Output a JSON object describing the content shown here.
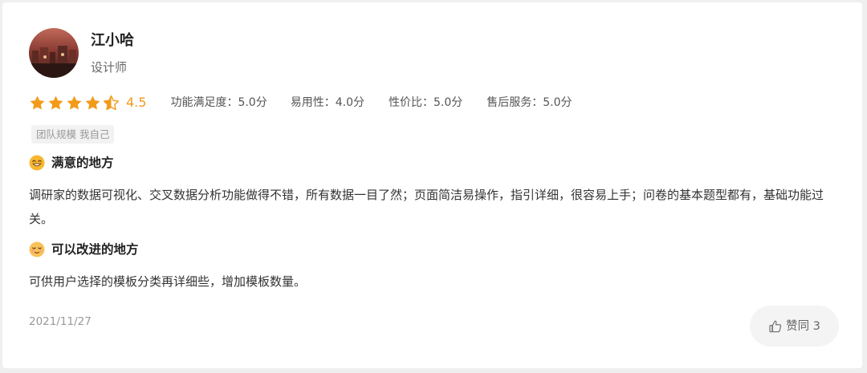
{
  "reviewer": {
    "name": "江小哈",
    "role": "设计师"
  },
  "rating": {
    "score": "4.5",
    "stars_filled": 4.5,
    "stars_total": 5,
    "star_color": "#f29a19",
    "metrics": [
      {
        "label": "功能满足度：5.0分"
      },
      {
        "label": "易用性：4.0分"
      },
      {
        "label": "性价比：5.0分"
      },
      {
        "label": "售后服务：5.0分"
      }
    ]
  },
  "tag": "团队规模 我自己",
  "pros": {
    "title": "满意的地方",
    "icon": "smiling-face-icon",
    "text": "调研家的数据可视化、交叉数据分析功能做得不错，所有数据一目了然；页面简洁易操作，指引详细，很容易上手；问卷的基本题型都有，基础功能过关。"
  },
  "cons": {
    "title": "可以改进的地方",
    "icon": "relieved-face-icon",
    "text": "可供用户选择的模板分类再详细些，增加模板数量。"
  },
  "date": "2021/11/27",
  "like": {
    "label": "赞同 3",
    "icon": "thumbs-up-icon"
  }
}
